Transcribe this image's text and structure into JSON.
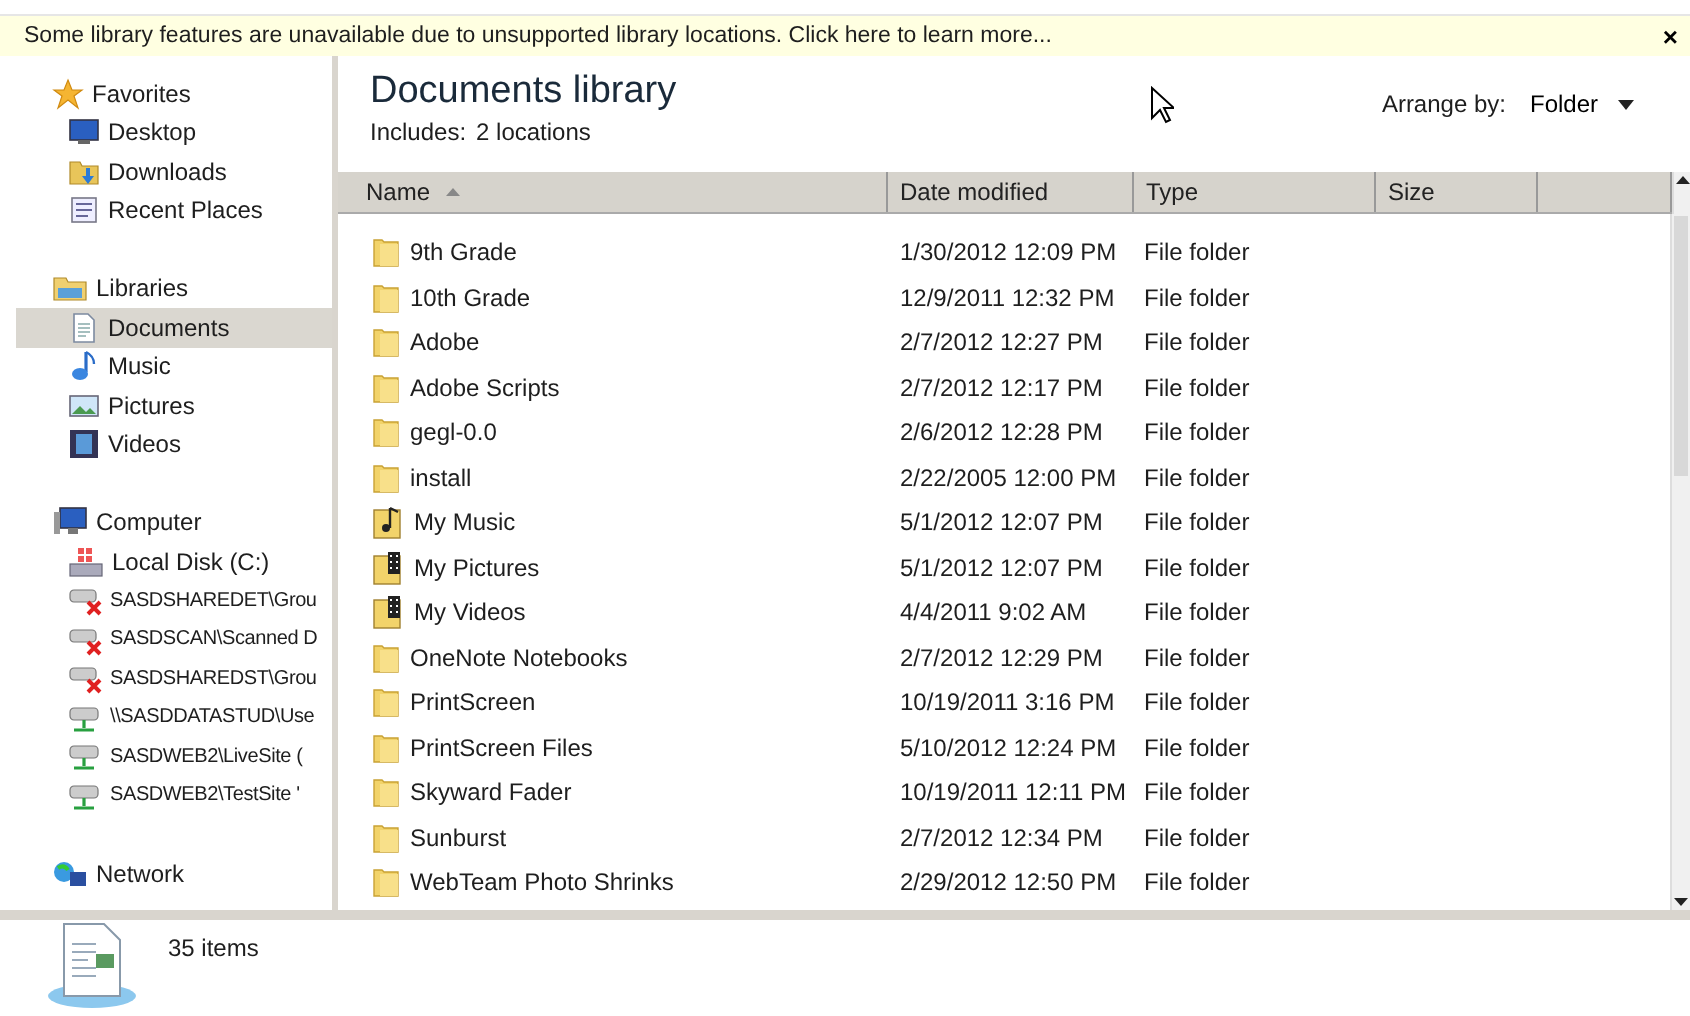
{
  "info_bar": {
    "message": "Some library features are unavailable due to unsupported library locations. Click here to learn more...",
    "close": "×"
  },
  "navigation": [
    {
      "label": "Favorites",
      "kind": "favorites",
      "selected": false,
      "children": [
        {
          "label": "Desktop",
          "kind": "desktop",
          "selected": false
        },
        {
          "label": "Downloads",
          "kind": "downloads",
          "selected": false
        },
        {
          "label": "Recent Places",
          "kind": "recent",
          "selected": false
        }
      ]
    },
    {
      "label": "Libraries",
      "kind": "library",
      "selected": false,
      "children": [
        {
          "label": "Documents",
          "kind": "documents",
          "selected": true
        },
        {
          "label": "Music",
          "kind": "music",
          "selected": false
        },
        {
          "label": "Pictures",
          "kind": "pictures",
          "selected": false
        },
        {
          "label": "Videos",
          "kind": "videos",
          "selected": false
        }
      ]
    },
    {
      "label": "Computer",
      "kind": "computer",
      "selected": false,
      "children": [
        {
          "label": "Local Disk (C:)",
          "kind": "disk",
          "selected": false
        },
        {
          "label": "SASDSHAREDET\\Grou",
          "kind": "drive-offline",
          "selected": false
        },
        {
          "label": "SASDSCAN\\Scanned D",
          "kind": "drive-offline",
          "selected": false
        },
        {
          "label": "SASDSHAREDST\\Grou",
          "kind": "drive-offline",
          "selected": false
        },
        {
          "label": "\\\\SASDDATASTUD\\Use",
          "kind": "drive",
          "selected": false
        },
        {
          "label": "SASDWEB2\\LiveSite (",
          "kind": "drive",
          "selected": false
        },
        {
          "label": "SASDWEB2\\TestSite '",
          "kind": "drive",
          "selected": false
        }
      ]
    },
    {
      "label": "Network",
      "kind": "network",
      "selected": false
    }
  ],
  "library": {
    "title": "Documents library",
    "includes_label": "Includes:",
    "includes_link": "2 locations",
    "arrange_label": "Arrange by:",
    "arrange_value": "Folder"
  },
  "table": {
    "columns": [
      {
        "label": "Name",
        "sorted": true
      },
      {
        "label": "Date modified",
        "sorted": false
      },
      {
        "label": "Type",
        "sorted": false
      },
      {
        "label": "Size",
        "sorted": false
      }
    ],
    "rows": [
      {
        "name": "9th Grade",
        "kind": "folder",
        "date": "1/30/2012 12:09 PM",
        "type": "File folder"
      },
      {
        "name": "10th Grade",
        "kind": "folder",
        "date": "12/9/2011 12:32 PM",
        "type": "File folder"
      },
      {
        "name": "Adobe",
        "kind": "folder",
        "date": "2/7/2012 12:27 PM",
        "type": "File folder"
      },
      {
        "name": "Adobe Scripts",
        "kind": "folder",
        "date": "2/7/2012 12:17 PM",
        "type": "File folder"
      },
      {
        "name": "gegl-0.0",
        "kind": "folder",
        "date": "2/6/2012 12:28 PM",
        "type": "File folder"
      },
      {
        "name": "install",
        "kind": "folder",
        "date": "2/22/2005 12:00 PM",
        "type": "File folder"
      },
      {
        "name": "My Music",
        "kind": "music-folder",
        "date": "5/1/2012 12:07 PM",
        "type": "File folder"
      },
      {
        "name": "My Pictures",
        "kind": "media-folder",
        "date": "5/1/2012 12:07 PM",
        "type": "File folder"
      },
      {
        "name": "My Videos",
        "kind": "media-folder",
        "date": "4/4/2011 9:02 AM",
        "type": "File folder"
      },
      {
        "name": "OneNote Notebooks",
        "kind": "folder",
        "date": "2/7/2012 12:29 PM",
        "type": "File folder"
      },
      {
        "name": "PrintScreen",
        "kind": "folder",
        "date": "10/19/2011 3:16 PM",
        "type": "File folder"
      },
      {
        "name": "PrintScreen Files",
        "kind": "folder",
        "date": "5/10/2012 12:24 PM",
        "type": "File folder"
      },
      {
        "name": "Skyward Fader",
        "kind": "folder",
        "date": "10/19/2011 12:11 PM",
        "type": "File folder"
      },
      {
        "name": "Sunburst",
        "kind": "folder",
        "date": "2/7/2012 12:34 PM",
        "type": "File folder"
      },
      {
        "name": "WebTeam Photo Shrinks",
        "kind": "folder",
        "date": "2/29/2012 12:50 PM",
        "type": "File folder"
      }
    ]
  },
  "details": {
    "count": "35 items"
  }
}
